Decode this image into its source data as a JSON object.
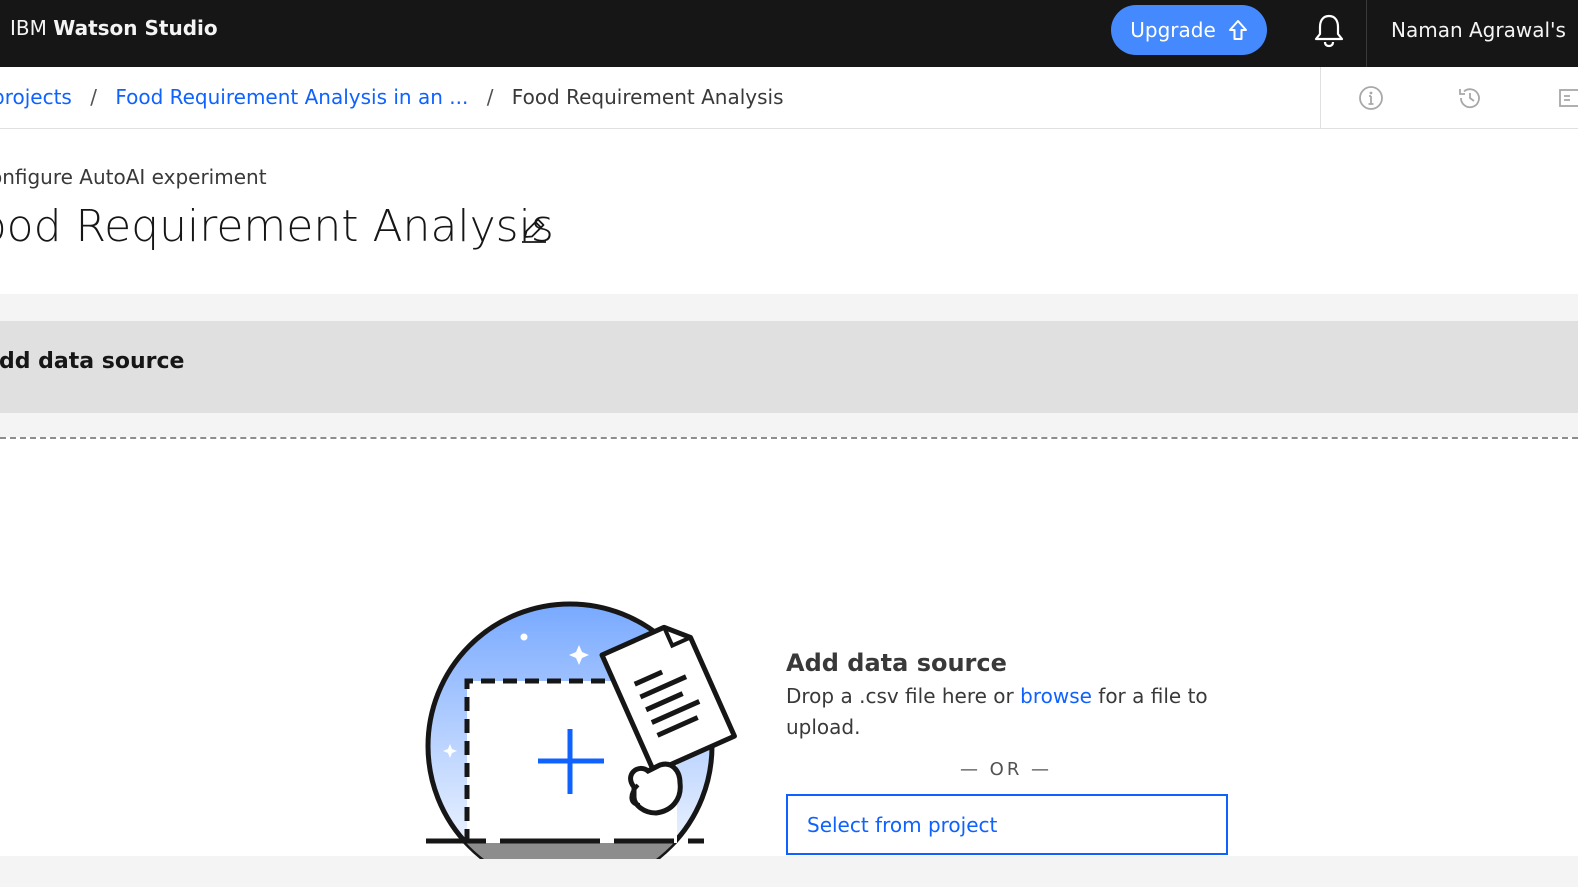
{
  "header": {
    "brand_prefix": "IBM",
    "brand_name": "Watson Studio",
    "upgrade_label": "Upgrade",
    "account_label": "Naman Agrawal's"
  },
  "breadcrumb": {
    "items": [
      "projects",
      "Food Requirement Analysis in an ..."
    ],
    "current": "Food Requirement Analysis",
    "separator": "/"
  },
  "page": {
    "subtitle": "Configure AutoAI experiment",
    "title": "Food Requirement Analysis"
  },
  "section": {
    "title": "Add data source"
  },
  "dropzone": {
    "title": "Add data source",
    "desc_before": "Drop a .csv file here or ",
    "browse_link": "browse",
    "desc_after": " for a file to upload.",
    "or_text": "— OR —",
    "select_label": "Select from project"
  },
  "icons": {
    "upgrade": "arrow-up-icon",
    "notifications": "bell-icon",
    "info": "info-icon",
    "history": "history-icon",
    "edit": "pencil-icon"
  },
  "colors": {
    "accent": "#0f62fe",
    "upgrade_bg": "#4589ff",
    "header_bg": "#161616"
  }
}
